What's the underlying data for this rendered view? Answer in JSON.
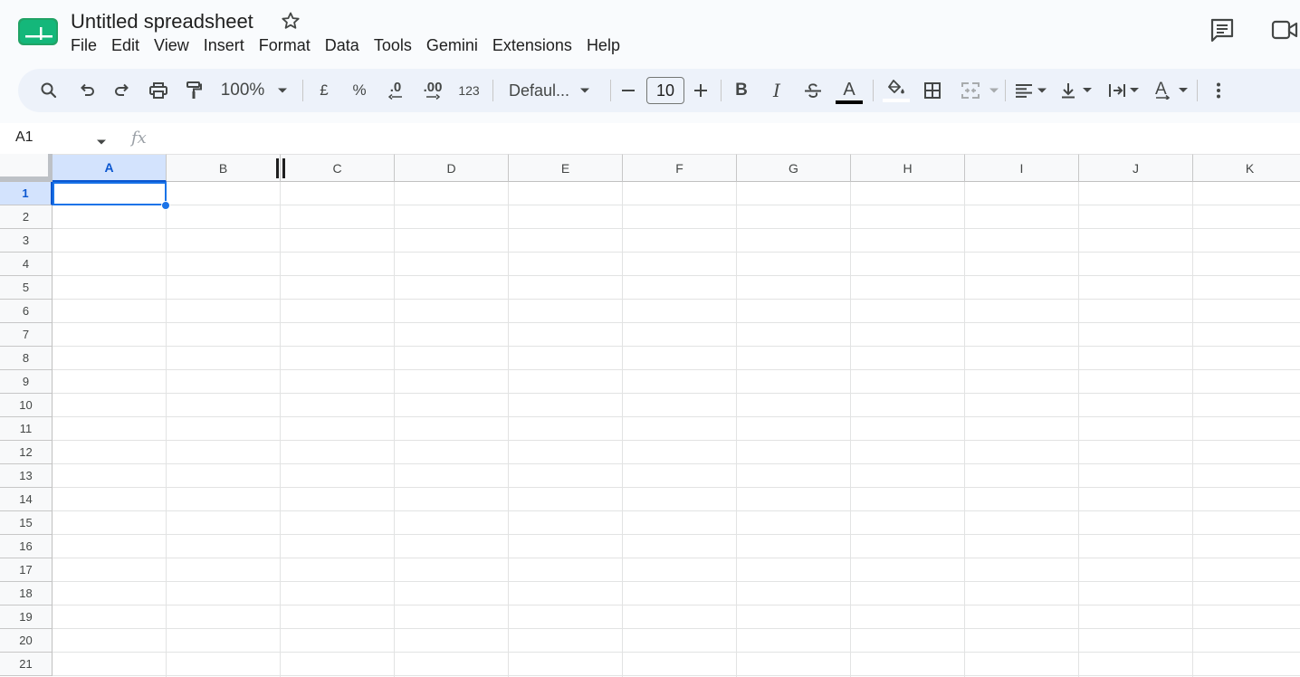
{
  "app": {
    "title": "Untitled spreadsheet",
    "accent": "#0b57d0",
    "logo_color": "#0f9d58"
  },
  "menu": [
    "File",
    "Edit",
    "View",
    "Insert",
    "Format",
    "Data",
    "Tools",
    "Gemini",
    "Extensions",
    "Help"
  ],
  "toolbar": {
    "zoom": "100%",
    "currency": "£",
    "percent": "%",
    "decrease_decimal": ".0",
    "increase_decimal": ".00",
    "more_formats": "123",
    "font": "Defaul...",
    "font_size_minus": "–",
    "font_size": "10",
    "font_size_plus": "+",
    "bold": "B",
    "italic": "I",
    "text_color_glyph": "A",
    "text_rotation_glyph": "A"
  },
  "formula_bar": {
    "name_box": "A1",
    "fx": "fx",
    "value": ""
  },
  "grid": {
    "columns": [
      "A",
      "B",
      "C",
      "D",
      "E",
      "F",
      "G",
      "H",
      "I",
      "J",
      "K"
    ],
    "rows": [
      "1",
      "2",
      "3",
      "4",
      "5",
      "6",
      "7",
      "8",
      "9",
      "10",
      "11",
      "12",
      "13",
      "14",
      "15",
      "16",
      "17",
      "18",
      "19",
      "20",
      "21"
    ],
    "selected_column": "A",
    "selected_row": "1",
    "active_cell": "A1"
  }
}
